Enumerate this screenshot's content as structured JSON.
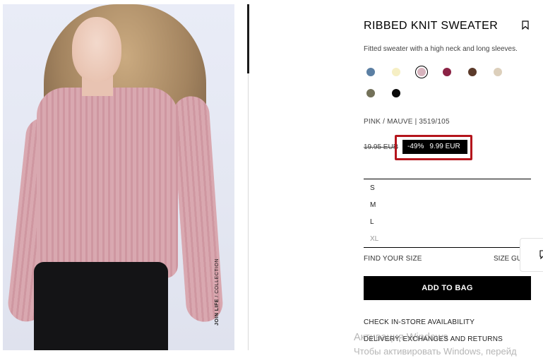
{
  "product": {
    "title": "RIBBED KNIT SWEATER",
    "description": "Fitted sweater with a high neck and long sleeves.",
    "color_code": "PINK / MAUVE | 3519/105",
    "old_price": "19.95 EUR",
    "discount": "-49%",
    "new_price": "9.99 EUR"
  },
  "photo": {
    "tag_bold": "JOIN LIFE",
    "tag_rest": " / COLLECTION"
  },
  "colors": [
    {
      "name": "blue",
      "hex": "#5b7fa3"
    },
    {
      "name": "cream",
      "hex": "#f6efc4"
    },
    {
      "name": "pink-mauve",
      "hex": "#d7b3bd",
      "selected": true
    },
    {
      "name": "burgundy",
      "hex": "#8b2345"
    },
    {
      "name": "brown",
      "hex": "#5b3a2a"
    },
    {
      "name": "beige",
      "hex": "#dccfbb"
    },
    {
      "name": "olive",
      "hex": "#737159"
    },
    {
      "name": "black",
      "hex": "#0a0a0a"
    }
  ],
  "sizes": [
    {
      "label": "S",
      "available": true
    },
    {
      "label": "M",
      "available": true
    },
    {
      "label": "L",
      "available": true
    },
    {
      "label": "XL",
      "available": false
    }
  ],
  "actions": {
    "find_your_size": "FIND YOUR SIZE",
    "size_guide": "SIZE GU",
    "add_to_bag": "ADD TO BAG",
    "check_store": "CHECK IN-STORE AVAILABILITY",
    "delivery": "DELIVERY, EXCHANGES AND RETURNS"
  },
  "icons": {
    "bookmark": "bookmark-icon",
    "chat": "chat-icon"
  },
  "watermark": {
    "line1": "Активация Windows",
    "line2": "Чтобы активировать Windows, перейд"
  },
  "highlight_color": "#b4151c"
}
